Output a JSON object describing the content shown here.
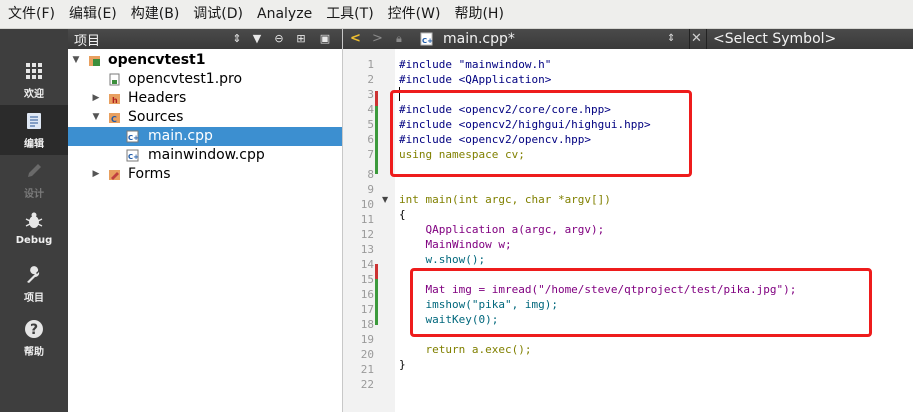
{
  "menubar": {
    "items": [
      "文件(F)",
      "编辑(E)",
      "构建(B)",
      "调试(D)",
      "Analyze",
      "工具(T)",
      "控件(W)",
      "帮助(H)"
    ]
  },
  "modes": [
    {
      "label": "欢迎",
      "icon": "grid-icon"
    },
    {
      "label": "编辑",
      "icon": "document-icon"
    },
    {
      "label": "设计",
      "icon": "pencil-icon"
    },
    {
      "label": "Debug",
      "icon": "bug-icon"
    },
    {
      "label": "项目",
      "icon": "wrench-icon"
    },
    {
      "label": "帮助",
      "icon": "help-icon"
    }
  ],
  "project": {
    "title": "项目",
    "tree": [
      {
        "label": "opencvtest1",
        "level": 0,
        "expanded": true,
        "bold": true
      },
      {
        "label": "opencvtest1.pro",
        "level": 1
      },
      {
        "label": "Headers",
        "level": 1,
        "expanded": false
      },
      {
        "label": "Sources",
        "level": 1,
        "expanded": true
      },
      {
        "label": "main.cpp",
        "level": 2,
        "selected": true
      },
      {
        "label": "mainwindow.cpp",
        "level": 2
      },
      {
        "label": "Forms",
        "level": 1,
        "expanded": false
      }
    ]
  },
  "editor": {
    "filename": "main.cpp*",
    "symbol": "<Select Symbol>",
    "line_numbers": [
      "1",
      "2",
      "3",
      "4",
      "5",
      "6",
      "7",
      "8",
      "9",
      "10",
      "11",
      "12",
      "13",
      "14",
      "15",
      "16",
      "17",
      "18",
      "19",
      "20",
      "21",
      "22"
    ],
    "lines": [
      "#include \"mainwindow.h\"",
      "#include <QApplication>",
      "",
      "#include <opencv2/core/core.hpp>",
      "#include <opencv2/highgui/highgui.hpp>",
      "#include <opencv2/opencv.hpp>",
      "using namespace cv;",
      "",
      "",
      "int main(int argc, char *argv[])",
      "{",
      "    QApplication a(argc, argv);",
      "    MainWindow w;",
      "    w.show();",
      "",
      "    Mat img = imread(\"/home/steve/qtproject/test/pika.jpg\");",
      "    imshow(\"pika\", img);",
      "    waitKey(0);",
      "",
      "    return a.exec();",
      "}",
      ""
    ]
  },
  "colors": {
    "highlight": "#ee1c1c",
    "selection": "#3c8fd0"
  }
}
